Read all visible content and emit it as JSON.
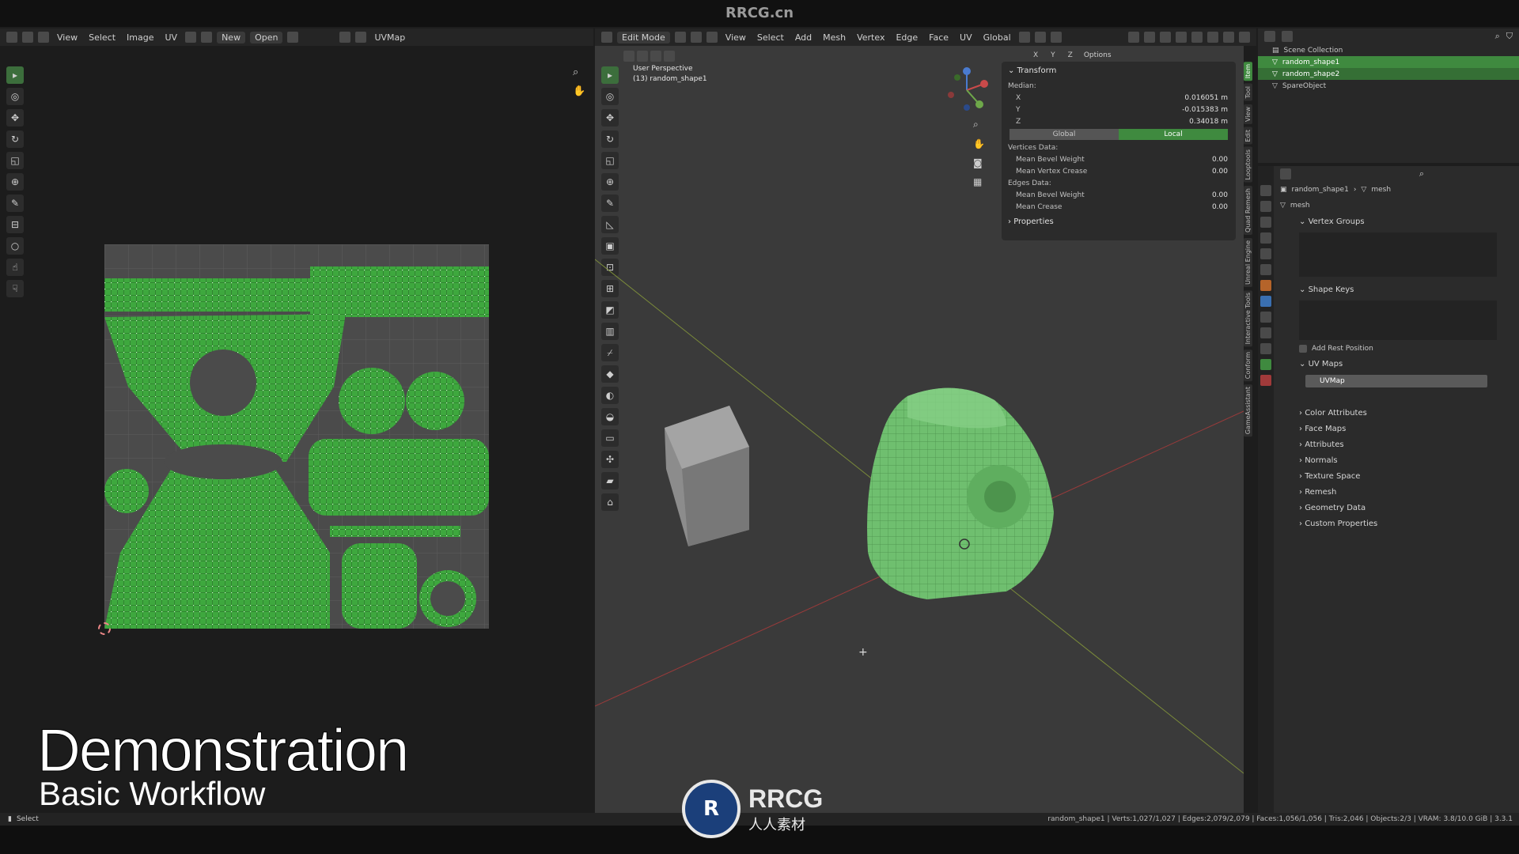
{
  "watermark": "RRCG.cn",
  "uv_editor": {
    "menu": [
      "View",
      "Select",
      "Image",
      "UV"
    ],
    "new_label": "New",
    "open_label": "Open",
    "image_name": "UVMap"
  },
  "viewport_header": {
    "mode": "Edit Mode",
    "menu": [
      "View",
      "Select",
      "Add",
      "Mesh",
      "Vertex",
      "Edge",
      "Face",
      "UV"
    ],
    "orientation": "Global",
    "options": "Options",
    "axes": [
      "X",
      "Y",
      "Z"
    ]
  },
  "viewport": {
    "view_name": "User Perspective",
    "object_name": "(13) random_shape1"
  },
  "transform_panel": {
    "title": "Transform",
    "median_label": "Median:",
    "x_label": "X",
    "x_value": "0.016051 m",
    "y_label": "Y",
    "y_value": "-0.015383 m",
    "z_label": "Z",
    "z_value": "0.34018 m",
    "global_label": "Global",
    "local_label": "Local",
    "vertices_data": "Vertices Data:",
    "mean_bevel_weight": "Mean Bevel Weight",
    "mean_bevel_weight_value": "0.00",
    "mean_vertex_crease": "Mean Vertex Crease",
    "mean_vertex_crease_value": "0.00",
    "edges_data": "Edges Data:",
    "edge_mean_bevel_weight": "Mean Bevel Weight",
    "edge_mean_bevel_weight_value": "0.00",
    "mean_crease": "Mean Crease",
    "mean_crease_value": "0.00",
    "properties_label": "Properties"
  },
  "side_tabs": [
    "Item",
    "Tool",
    "View",
    "Edit",
    "Looptools",
    "Quad Remesh",
    "Unreal Engine",
    "Interactive Tools",
    "Conform",
    "GameAssistant"
  ],
  "outliner": {
    "collection": "Scene Collection",
    "items": [
      "random_shape1",
      "random_shape2",
      "SpareObject"
    ]
  },
  "properties": {
    "breadcrumb_object": "random_shape1",
    "breadcrumb_data": "mesh",
    "mesh_name": "mesh",
    "sections": {
      "vertex_groups": "Vertex Groups",
      "shape_keys": "Shape Keys",
      "add_rest_position": "Add Rest Position",
      "uv_maps": "UV Maps",
      "uv_map_item": "UVMap",
      "color_attributes": "Color Attributes",
      "face_maps": "Face Maps",
      "attributes": "Attributes",
      "normals": "Normals",
      "texture_space": "Texture Space",
      "remesh": "Remesh",
      "geometry_data": "Geometry Data",
      "custom_properties": "Custom Properties"
    }
  },
  "overlay_title": {
    "main": "Demonstration",
    "sub": "Basic Workflow"
  },
  "statusbar": {
    "left": "Select",
    "stats": "random_shape1 | Verts:1,027/1,027 | Edges:2,079/2,079 | Faces:1,056/1,056 | Tris:2,046 | Objects:2/3 | VRAM: 3.8/10.0 GiB | 3.3.1"
  },
  "logo": {
    "text": "RRCG",
    "sub": "人人素材"
  },
  "colors": {
    "accent_green": "#3f8a3f",
    "mesh_green": "#6fbf6f",
    "uv_green": "#3ea83e"
  }
}
